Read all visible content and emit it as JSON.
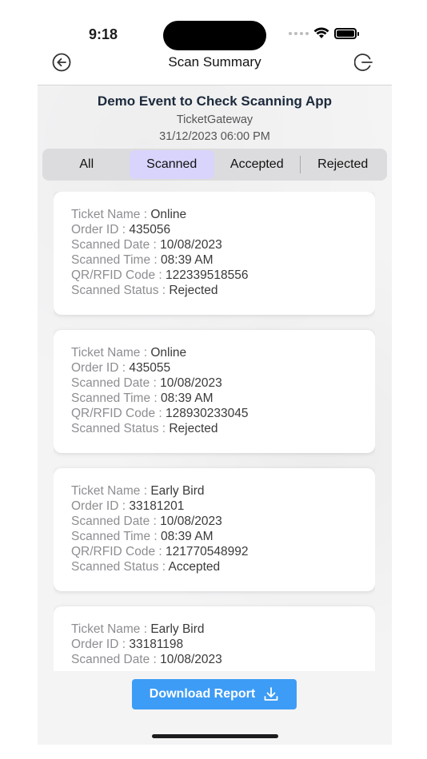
{
  "status_bar": {
    "time": "9:18"
  },
  "nav": {
    "title": "Scan Summary",
    "back_icon": "arrow-left-circle-icon",
    "logout_icon": "logout-icon"
  },
  "event": {
    "name": "Demo Event to Check Scanning App",
    "organizer": "TicketGateway",
    "datetime": "31/12/2023 06:00 PM"
  },
  "tabs": [
    {
      "label": "All",
      "active": false
    },
    {
      "label": "Scanned",
      "active": true
    },
    {
      "label": "Accepted",
      "active": false
    },
    {
      "label": "Rejected",
      "active": false
    }
  ],
  "labels": {
    "ticket_name": "Ticket Name : ",
    "order_id": "Order ID : ",
    "scanned_date": "Scanned Date : ",
    "scanned_time": "Scanned Time : ",
    "qr_code": "QR/RFID Code : ",
    "scanned_status": "Scanned Status : "
  },
  "tickets": [
    {
      "ticket_name": "Online",
      "order_id": "435056",
      "scanned_date": "10/08/2023",
      "scanned_time": "08:39 AM",
      "qr_code": "122339518556",
      "scanned_status": "Rejected"
    },
    {
      "ticket_name": "Online",
      "order_id": "435055",
      "scanned_date": "10/08/2023",
      "scanned_time": "08:39 AM",
      "qr_code": "128930233045",
      "scanned_status": "Rejected"
    },
    {
      "ticket_name": "Early Bird",
      "order_id": "33181201",
      "scanned_date": "10/08/2023",
      "scanned_time": "08:39 AM",
      "qr_code": "121770548992",
      "scanned_status": "Accepted"
    },
    {
      "ticket_name": "Early Bird",
      "order_id": "33181198",
      "scanned_date": "10/08/2023"
    }
  ],
  "download": {
    "label": "Download Report",
    "icon": "download-icon"
  },
  "colors": {
    "accent": "#3d9cf5",
    "active_tab": "#d8d4fb"
  }
}
